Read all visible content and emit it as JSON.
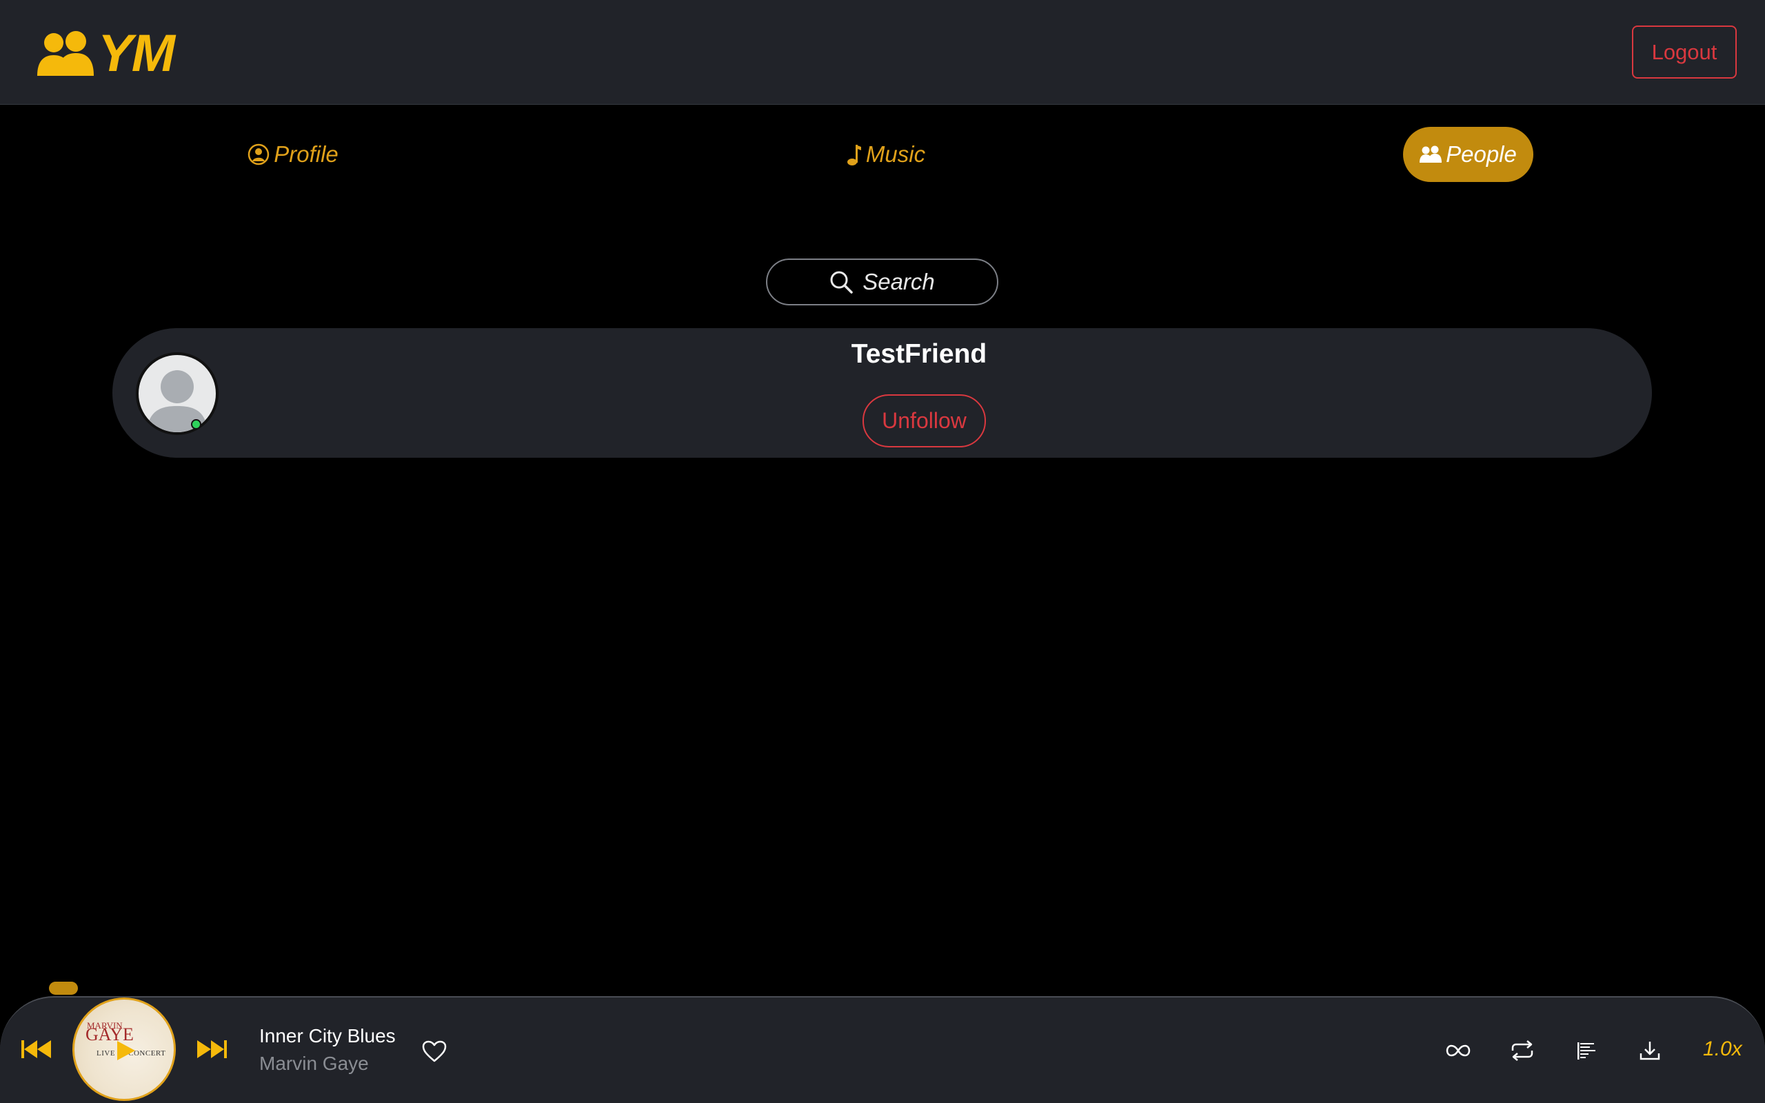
{
  "header": {
    "logo_text": "YM",
    "logo_icon": "people-icon",
    "logout_label": "Logout"
  },
  "nav": {
    "tabs": [
      {
        "label": "Profile",
        "icon": "person-circle-icon",
        "active": false
      },
      {
        "label": "Music",
        "icon": "music-note-icon",
        "active": false
      },
      {
        "label": "People",
        "icon": "people-icon",
        "active": true
      }
    ]
  },
  "search": {
    "label": "Search",
    "icon": "search-icon"
  },
  "people": [
    {
      "name": "TestFriend",
      "action_label": "Unfollow",
      "online": true
    }
  ],
  "player": {
    "track_title": "Inner City Blues",
    "track_artist": "Marvin Gaye",
    "album_art_text": {
      "small": "MARVIN",
      "title": "GAYE",
      "sub": "LIVE IN CONCERT"
    },
    "speed": "1.0x",
    "controls": [
      "previous-icon",
      "play-icon",
      "next-icon",
      "heart-icon",
      "infinity-icon",
      "repeat-icon",
      "queue-icon",
      "download-icon"
    ]
  },
  "colors": {
    "accent": "#f5b90b",
    "accent_dark": "#c28b0e",
    "danger": "#d9383f",
    "surface": "#212329",
    "background": "#000000",
    "online": "#2ed15c"
  }
}
